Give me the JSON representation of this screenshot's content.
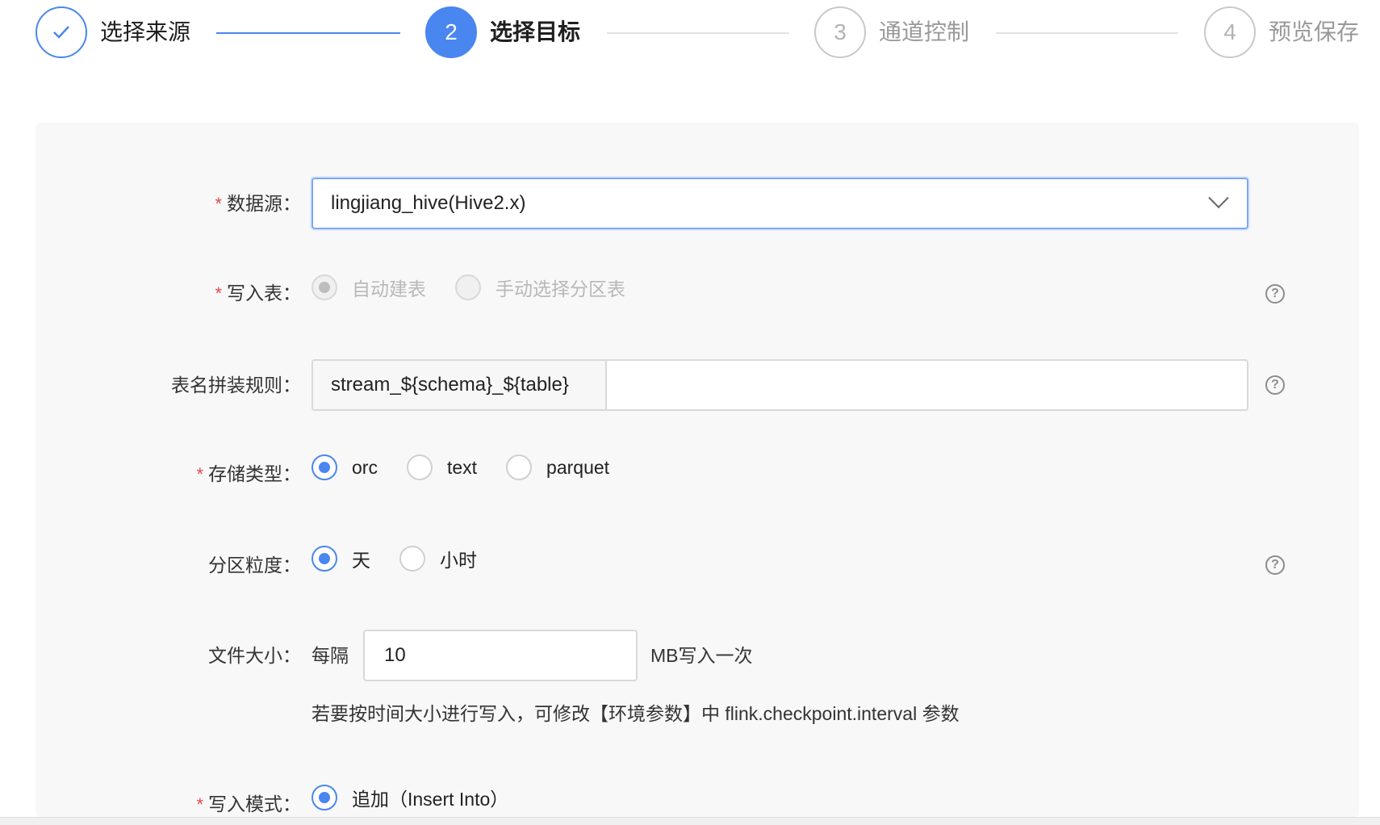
{
  "steps": [
    {
      "index": "1",
      "title": "选择来源",
      "status": "done"
    },
    {
      "index": "2",
      "title": "选择目标",
      "status": "active"
    },
    {
      "index": "3",
      "title": "通道控制",
      "status": "pending"
    },
    {
      "index": "4",
      "title": "预览保存",
      "status": "pending"
    }
  ],
  "form": {
    "required_mark": "*",
    "datasource": {
      "label": "数据源：",
      "value": "lingjiang_hive(Hive2.x)"
    },
    "write_table": {
      "label": "写入表：",
      "options": [
        {
          "label": "自动建表",
          "checked": true,
          "disabled": true
        },
        {
          "label": "手动选择分区表",
          "checked": false,
          "disabled": true
        }
      ]
    },
    "table_name_rule": {
      "label": "表名拼装规则：",
      "addon": "stream_${schema}_${table}",
      "value": ""
    },
    "storage_type": {
      "label": "存储类型：",
      "options": [
        {
          "label": "orc",
          "checked": true
        },
        {
          "label": "text",
          "checked": false
        },
        {
          "label": "parquet",
          "checked": false
        }
      ]
    },
    "partition": {
      "label": "分区粒度：",
      "options": [
        {
          "label": "天",
          "checked": true
        },
        {
          "label": "小时",
          "checked": false
        }
      ]
    },
    "file_size": {
      "label": "文件大小：",
      "prefix": "每隔",
      "value": "10",
      "suffix": "MB写入一次",
      "hint": "若要按时间大小进行写入，可修改【环境参数】中 flink.checkpoint.interval 参数"
    },
    "write_mode": {
      "label": "写入模式：",
      "options": [
        {
          "label": "追加（Insert Into）",
          "checked": true
        }
      ]
    }
  },
  "icons": {
    "check": "check-icon",
    "help": "question-circle-icon",
    "chevron": "chevron-down-icon"
  },
  "colors": {
    "primary": "#4a86f0",
    "required": "#e5484d",
    "panel_bg": "#f8f8f8"
  }
}
